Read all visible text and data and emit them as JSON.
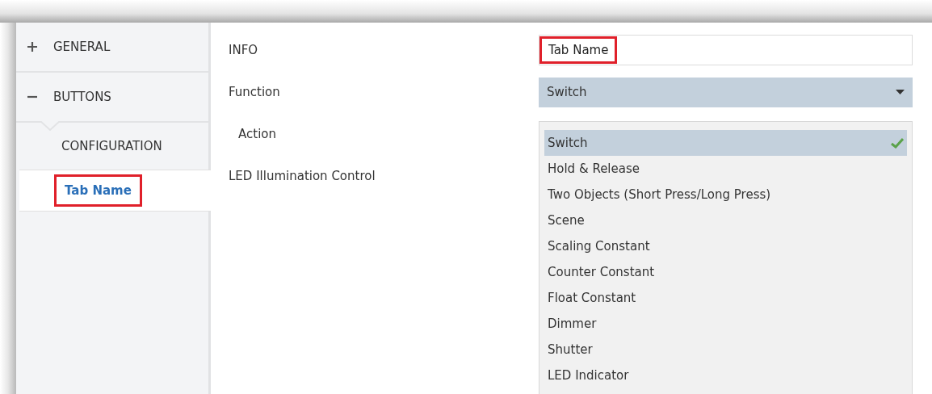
{
  "sidebar": {
    "items": [
      {
        "label": "GENERAL",
        "expanded": false
      },
      {
        "label": "BUTTONS",
        "expanded": true,
        "children": [
          {
            "label": "CONFIGURATION",
            "selected": false,
            "annotated": false
          },
          {
            "label": "Tab Name",
            "selected": true,
            "annotated": true
          }
        ]
      }
    ]
  },
  "parameters": [
    {
      "kind": "text",
      "label": "INFO",
      "value": "Tab Name",
      "annotated": true
    },
    {
      "kind": "select",
      "label": "Function",
      "value": "Switch",
      "open": true,
      "options": [
        {
          "label": "Switch",
          "selected": true
        },
        {
          "label": "Hold & Release",
          "selected": false
        },
        {
          "label": "Two Objects (Short Press/Long Press)",
          "selected": false
        },
        {
          "label": "Scene",
          "selected": false
        },
        {
          "label": "Scaling Constant",
          "selected": false
        },
        {
          "label": "Counter Constant",
          "selected": false
        },
        {
          "label": "Float Constant",
          "selected": false
        },
        {
          "label": "Dimmer",
          "selected": false
        },
        {
          "label": "Shutter",
          "selected": false
        },
        {
          "label": "LED Indicator",
          "selected": false
        }
      ]
    },
    {
      "kind": "sub",
      "label": "Action"
    },
    {
      "kind": "plain",
      "label": "LED Illumination Control"
    }
  ]
}
